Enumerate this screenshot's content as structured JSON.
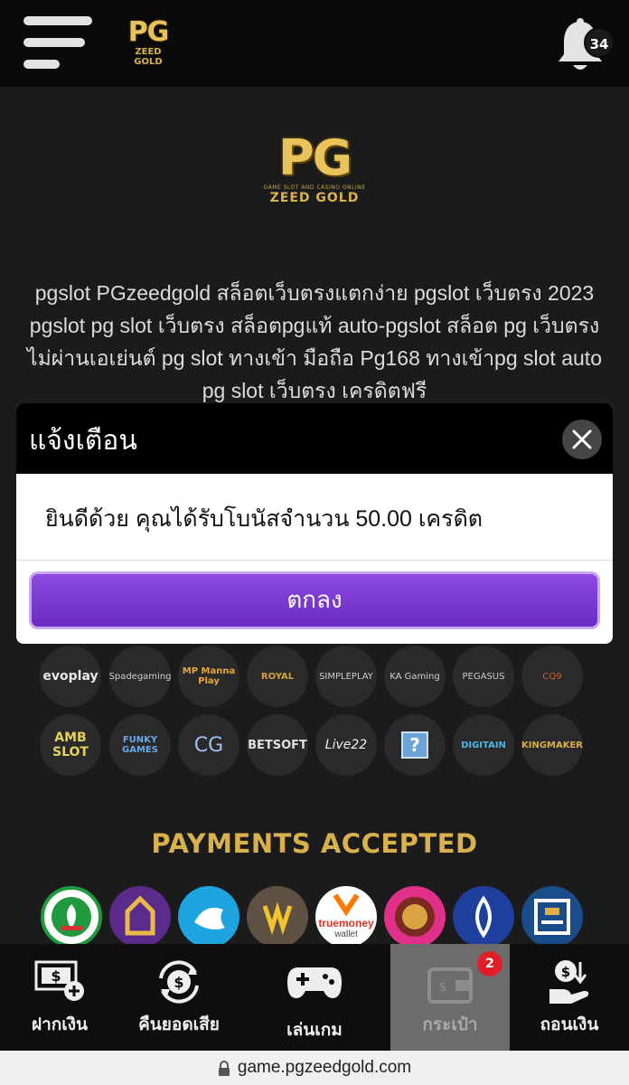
{
  "header": {
    "logo_pg": "PG",
    "logo_sub": "ZEED GOLD",
    "notification_count": "34"
  },
  "hero": {
    "logo_pg": "PG",
    "logo_tag": "GAME SLOT AND CASINO ONLINE",
    "logo_sub": "ZEED GOLD",
    "seo_text": "pgslot PGzeedgold สล็อตเว็บตรงแตกง่าย pgslot เว็บตรง 2023 pgslot pg slot เว็บตรง สล็อตpgแท้ auto-pgslot สล็อต pg เว็บตรง ไม่ผ่านเอเย่นต์ pg slot ทางเข้า มือถือ Pg168 ทางเข้าpg slot auto pg slot เว็บตรง เครดิตฟรี"
  },
  "providers": {
    "row1": [
      "evoplay",
      "Spadegaming",
      "MP Manna Play",
      "ROYAL",
      "SIMPLEPLAY",
      "KA Gaming",
      "PEGASUS",
      "CQ9"
    ],
    "row2": [
      "AMB SLOT",
      "FUNKY GAMES",
      "CG",
      "BETSOFT",
      "Live22",
      "?",
      "DIGITAIN",
      "KINGMAKER"
    ]
  },
  "payments": {
    "title": "PAYMENTS ACCEPTED",
    "truemoney_label": "truemoney",
    "truemoney_sub": "wallet"
  },
  "bottom_nav": {
    "deposit": "ฝากเงิน",
    "cashback": "คืนยอดเสีย",
    "play": "เล่นเกม",
    "wallet": "กระเป๋า",
    "wallet_badge": "2",
    "withdraw": "ถอนเงิน"
  },
  "browser": {
    "url": "game.pgzeedgold.com"
  },
  "modal": {
    "title": "แจ้งเตือน",
    "message": "ยินดีด้วย คุณได้รับโบนัสจำนวน 50.00 เครดิต",
    "ok_label": "ตกลง"
  },
  "colors": {
    "gold": "#d8b04c",
    "button_purple": "#7a3bd4",
    "badge_red": "#e02028"
  }
}
